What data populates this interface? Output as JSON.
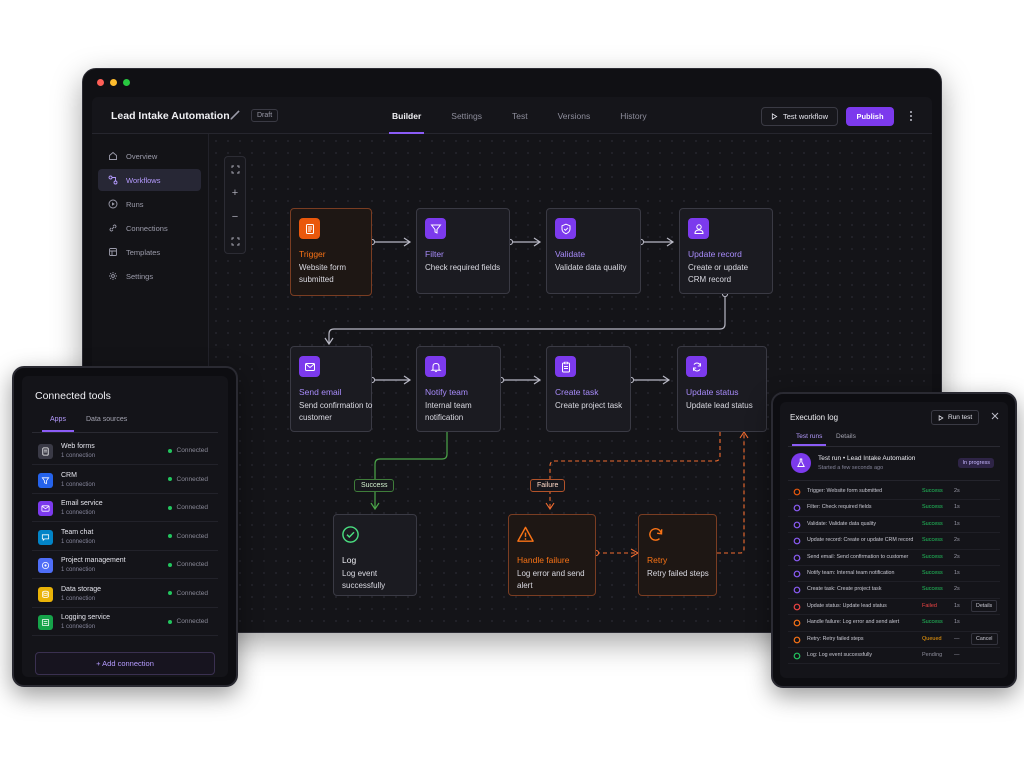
{
  "colors": {
    "accent": "#7c3aed",
    "accent_text": "#a78bfa",
    "trigger": "#ea580c",
    "success": "#22c55e",
    "failure": "#f97316",
    "canvas": "#141418"
  },
  "header": {
    "workflow_title": "Lead Intake Automation",
    "draft_badge": "Draft",
    "tabs": [
      {
        "label": "Builder",
        "active": true
      },
      {
        "label": "Settings"
      },
      {
        "label": "Test"
      },
      {
        "label": "Versions"
      },
      {
        "label": "History"
      }
    ],
    "test_workflow_label": "Test workflow",
    "publish_label": "Publish"
  },
  "sidebar": {
    "items": [
      {
        "label": "Overview",
        "icon": "home-icon"
      },
      {
        "label": "Workflows",
        "icon": "workflow-icon",
        "active": true
      },
      {
        "label": "Runs",
        "icon": "play-circle-icon"
      },
      {
        "label": "Connections",
        "icon": "link-icon"
      },
      {
        "label": "Templates",
        "icon": "template-icon"
      },
      {
        "label": "Settings",
        "icon": "gear-icon"
      }
    ]
  },
  "zoom_controls": {
    "fit": "fit-icon",
    "zoom_in": "+",
    "zoom_out": "−",
    "fullscreen": "fullscreen-icon"
  },
  "nodes": {
    "trigger": {
      "title": "Trigger",
      "desc": "Website form submitted",
      "icon": "form-icon"
    },
    "filter": {
      "title": "Filter",
      "desc": "Check required fields",
      "icon": "funnel-icon"
    },
    "validate": {
      "title": "Validate",
      "desc": "Validate data quality",
      "icon": "shield-check-icon"
    },
    "update_record": {
      "title": "Update record",
      "desc": "Create or update CRM record",
      "icon": "user-icon"
    },
    "send_email": {
      "title": "Send email",
      "desc": "Send confirmation to customer",
      "icon": "mail-icon"
    },
    "notify_team": {
      "title": "Notify team",
      "desc": "Internal team notification",
      "icon": "bell-icon"
    },
    "create_task": {
      "title": "Create task",
      "desc": "Create project task",
      "icon": "clipboard-icon"
    },
    "update_status": {
      "title": "Update status",
      "desc": "Update lead status",
      "icon": "refresh-icon"
    },
    "log": {
      "title": "Log",
      "desc": "Log event successfully",
      "icon": "check-circle-icon"
    },
    "handle_failure": {
      "title": "Handle failure",
      "desc": "Log error and send alert",
      "icon": "warning-icon"
    },
    "retry": {
      "title": "Retry",
      "desc": "Retry failed steps",
      "icon": "retry-icon"
    }
  },
  "edge_labels": {
    "success": "Success",
    "failure": "Failure"
  },
  "connected_tools": {
    "title": "Connected tools",
    "tabs": [
      {
        "label": "Apps",
        "active": true
      },
      {
        "label": "Data sources"
      }
    ],
    "items": [
      {
        "name": "Web forms",
        "sub": "1 connection",
        "status": "Connected",
        "color": "#3a3a46"
      },
      {
        "name": "CRM",
        "sub": "1 connection",
        "status": "Connected",
        "color": "#2563eb"
      },
      {
        "name": "Email service",
        "sub": "1 connection",
        "status": "Connected",
        "color": "#7c3aed"
      },
      {
        "name": "Team chat",
        "sub": "1 connection",
        "status": "Connected",
        "color": "#0284c7"
      },
      {
        "name": "Project management",
        "sub": "1 connection",
        "status": "Connected",
        "color": "#4f6ef7"
      },
      {
        "name": "Data storage",
        "sub": "1 connection",
        "status": "Connected",
        "color": "#eab308"
      },
      {
        "name": "Logging service",
        "sub": "1 connection",
        "status": "Connected",
        "color": "#16a34a"
      }
    ],
    "add_label": "+ Add connection"
  },
  "execution_log": {
    "title": "Execution log",
    "run_test_label": "Run test",
    "tabs": [
      {
        "label": "Test runs",
        "active": true
      },
      {
        "label": "Details"
      }
    ],
    "run": {
      "title": "Test run • Lead Intake Automation",
      "sub": "Started a few seconds ago",
      "badge": "In progress"
    },
    "rows": [
      {
        "text": "Trigger: Website form submitted",
        "status": "Success",
        "time": "2s",
        "kind": "success",
        "icon_color": "#ea580c"
      },
      {
        "text": "Filter: Check required fields",
        "status": "Success",
        "time": "1s",
        "kind": "success",
        "icon_color": "#8b5cf6"
      },
      {
        "text": "Validate: Validate data quality",
        "status": "Success",
        "time": "1s",
        "kind": "success",
        "icon_color": "#8b5cf6"
      },
      {
        "text": "Update record: Create or update CRM record",
        "status": "Success",
        "time": "2s",
        "kind": "success",
        "icon_color": "#8b5cf6"
      },
      {
        "text": "Send email: Send confirmation to customer",
        "status": "Success",
        "time": "2s",
        "kind": "success",
        "icon_color": "#8b5cf6"
      },
      {
        "text": "Notify team: Internal team notification",
        "status": "Success",
        "time": "1s",
        "kind": "success",
        "icon_color": "#8b5cf6"
      },
      {
        "text": "Create task: Create project task",
        "status": "Success",
        "time": "2s",
        "kind": "success",
        "icon_color": "#8b5cf6"
      },
      {
        "text": "Update status: Update lead status",
        "status": "Failed",
        "time": "1s",
        "kind": "failed",
        "action": "Details",
        "icon_color": "#ef4444"
      },
      {
        "text": "Handle failure: Log error and send alert",
        "status": "Success",
        "time": "1s",
        "kind": "success",
        "icon_color": "#f97316"
      },
      {
        "text": "Retry: Retry failed steps",
        "status": "Queued",
        "time": "—",
        "kind": "queued",
        "action": "Cancel",
        "icon_color": "#f97316"
      },
      {
        "text": "Log: Log event successfully",
        "status": "Pending",
        "time": "—",
        "kind": "pending",
        "icon_color": "#22c55e"
      }
    ]
  }
}
